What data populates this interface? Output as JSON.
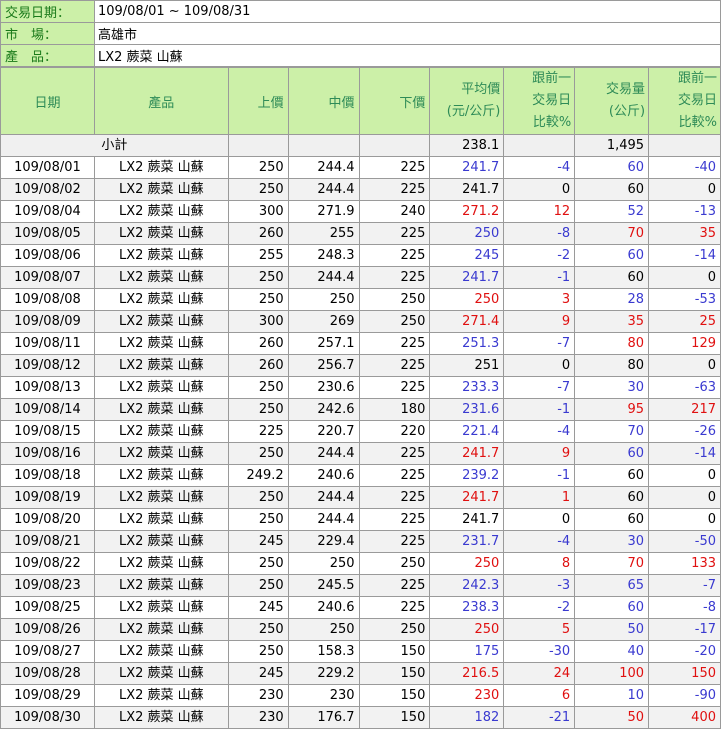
{
  "info": {
    "date_label": "交易日期：",
    "date_value": "109/08/01 ~ 109/08/31",
    "market_label": "市　場：",
    "market_value": "高雄市",
    "product_label": "產　品：",
    "product_value": "LX2 蕨菜 山蘇"
  },
  "headers": {
    "date": "日期",
    "product": "產品",
    "upper": "上價",
    "middle": "中價",
    "lower": "下價",
    "avg_l1": "平均價",
    "avg_l2": "(元/公斤)",
    "cmp_l1": "跟前一",
    "cmp_l2": "交易日",
    "cmp_l3": "比較%",
    "vol_l1": "交易量",
    "vol_l2": "(公斤)",
    "vcmp_l1": "跟前一",
    "vcmp_l2": "交易日",
    "vcmp_l3": "比較%"
  },
  "subtotal": {
    "label": "小計",
    "avg": "238.1",
    "volume": "1,495"
  },
  "colors": {
    "up": "#e01010",
    "down": "#3a3ad0",
    "header_bg": "#ccf0a8"
  },
  "rows": [
    {
      "date": "109/08/01",
      "product": "LX2 蕨菜 山蘇",
      "upper": "250",
      "middle": "244.4",
      "lower": "225",
      "avg": "241.7",
      "avg_pct": "-4",
      "volume": "60",
      "vol_pct": "-40"
    },
    {
      "date": "109/08/02",
      "product": "LX2 蕨菜 山蘇",
      "upper": "250",
      "middle": "244.4",
      "lower": "225",
      "avg": "241.7",
      "avg_pct": "0",
      "volume": "60",
      "vol_pct": "0"
    },
    {
      "date": "109/08/04",
      "product": "LX2 蕨菜 山蘇",
      "upper": "300",
      "middle": "271.9",
      "lower": "240",
      "avg": "271.2",
      "avg_pct": "12",
      "volume": "52",
      "vol_pct": "-13"
    },
    {
      "date": "109/08/05",
      "product": "LX2 蕨菜 山蘇",
      "upper": "260",
      "middle": "255",
      "lower": "225",
      "avg": "250",
      "avg_pct": "-8",
      "volume": "70",
      "vol_pct": "35"
    },
    {
      "date": "109/08/06",
      "product": "LX2 蕨菜 山蘇",
      "upper": "255",
      "middle": "248.3",
      "lower": "225",
      "avg": "245",
      "avg_pct": "-2",
      "volume": "60",
      "vol_pct": "-14"
    },
    {
      "date": "109/08/07",
      "product": "LX2 蕨菜 山蘇",
      "upper": "250",
      "middle": "244.4",
      "lower": "225",
      "avg": "241.7",
      "avg_pct": "-1",
      "volume": "60",
      "vol_pct": "0"
    },
    {
      "date": "109/08/08",
      "product": "LX2 蕨菜 山蘇",
      "upper": "250",
      "middle": "250",
      "lower": "250",
      "avg": "250",
      "avg_pct": "3",
      "volume": "28",
      "vol_pct": "-53"
    },
    {
      "date": "109/08/09",
      "product": "LX2 蕨菜 山蘇",
      "upper": "300",
      "middle": "269",
      "lower": "250",
      "avg": "271.4",
      "avg_pct": "9",
      "volume": "35",
      "vol_pct": "25"
    },
    {
      "date": "109/08/11",
      "product": "LX2 蕨菜 山蘇",
      "upper": "260",
      "middle": "257.1",
      "lower": "225",
      "avg": "251.3",
      "avg_pct": "-7",
      "volume": "80",
      "vol_pct": "129"
    },
    {
      "date": "109/08/12",
      "product": "LX2 蕨菜 山蘇",
      "upper": "260",
      "middle": "256.7",
      "lower": "225",
      "avg": "251",
      "avg_pct": "0",
      "volume": "80",
      "vol_pct": "0"
    },
    {
      "date": "109/08/13",
      "product": "LX2 蕨菜 山蘇",
      "upper": "250",
      "middle": "230.6",
      "lower": "225",
      "avg": "233.3",
      "avg_pct": "-7",
      "volume": "30",
      "vol_pct": "-63"
    },
    {
      "date": "109/08/14",
      "product": "LX2 蕨菜 山蘇",
      "upper": "250",
      "middle": "242.6",
      "lower": "180",
      "avg": "231.6",
      "avg_pct": "-1",
      "volume": "95",
      "vol_pct": "217"
    },
    {
      "date": "109/08/15",
      "product": "LX2 蕨菜 山蘇",
      "upper": "225",
      "middle": "220.7",
      "lower": "220",
      "avg": "221.4",
      "avg_pct": "-4",
      "volume": "70",
      "vol_pct": "-26"
    },
    {
      "date": "109/08/16",
      "product": "LX2 蕨菜 山蘇",
      "upper": "250",
      "middle": "244.4",
      "lower": "225",
      "avg": "241.7",
      "avg_pct": "9",
      "volume": "60",
      "vol_pct": "-14"
    },
    {
      "date": "109/08/18",
      "product": "LX2 蕨菜 山蘇",
      "upper": "249.2",
      "middle": "240.6",
      "lower": "225",
      "avg": "239.2",
      "avg_pct": "-1",
      "volume": "60",
      "vol_pct": "0"
    },
    {
      "date": "109/08/19",
      "product": "LX2 蕨菜 山蘇",
      "upper": "250",
      "middle": "244.4",
      "lower": "225",
      "avg": "241.7",
      "avg_pct": "1",
      "volume": "60",
      "vol_pct": "0"
    },
    {
      "date": "109/08/20",
      "product": "LX2 蕨菜 山蘇",
      "upper": "250",
      "middle": "244.4",
      "lower": "225",
      "avg": "241.7",
      "avg_pct": "0",
      "volume": "60",
      "vol_pct": "0"
    },
    {
      "date": "109/08/21",
      "product": "LX2 蕨菜 山蘇",
      "upper": "245",
      "middle": "229.4",
      "lower": "225",
      "avg": "231.7",
      "avg_pct": "-4",
      "volume": "30",
      "vol_pct": "-50"
    },
    {
      "date": "109/08/22",
      "product": "LX2 蕨菜 山蘇",
      "upper": "250",
      "middle": "250",
      "lower": "250",
      "avg": "250",
      "avg_pct": "8",
      "volume": "70",
      "vol_pct": "133"
    },
    {
      "date": "109/08/23",
      "product": "LX2 蕨菜 山蘇",
      "upper": "250",
      "middle": "245.5",
      "lower": "225",
      "avg": "242.3",
      "avg_pct": "-3",
      "volume": "65",
      "vol_pct": "-7"
    },
    {
      "date": "109/08/25",
      "product": "LX2 蕨菜 山蘇",
      "upper": "245",
      "middle": "240.6",
      "lower": "225",
      "avg": "238.3",
      "avg_pct": "-2",
      "volume": "60",
      "vol_pct": "-8"
    },
    {
      "date": "109/08/26",
      "product": "LX2 蕨菜 山蘇",
      "upper": "250",
      "middle": "250",
      "lower": "250",
      "avg": "250",
      "avg_pct": "5",
      "volume": "50",
      "vol_pct": "-17"
    },
    {
      "date": "109/08/27",
      "product": "LX2 蕨菜 山蘇",
      "upper": "250",
      "middle": "158.3",
      "lower": "150",
      "avg": "175",
      "avg_pct": "-30",
      "volume": "40",
      "vol_pct": "-20"
    },
    {
      "date": "109/08/28",
      "product": "LX2 蕨菜 山蘇",
      "upper": "245",
      "middle": "229.2",
      "lower": "150",
      "avg": "216.5",
      "avg_pct": "24",
      "volume": "100",
      "vol_pct": "150"
    },
    {
      "date": "109/08/29",
      "product": "LX2 蕨菜 山蘇",
      "upper": "230",
      "middle": "230",
      "lower": "150",
      "avg": "230",
      "avg_pct": "6",
      "volume": "10",
      "vol_pct": "-90"
    },
    {
      "date": "109/08/30",
      "product": "LX2 蕨菜 山蘇",
      "upper": "230",
      "middle": "176.7",
      "lower": "150",
      "avg": "182",
      "avg_pct": "-21",
      "volume": "50",
      "vol_pct": "400"
    }
  ]
}
